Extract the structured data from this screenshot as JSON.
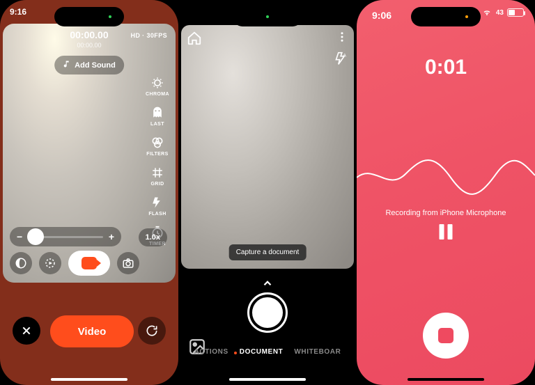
{
  "phone1": {
    "status_time": "9:16",
    "rec_time": "00:00.00",
    "rec_sub": "00:00.00",
    "quality": "HD · 30FPS",
    "add_sound": "Add Sound",
    "tools": {
      "chroma": "CHROMA",
      "last": "LAST",
      "filters": "FILTERS",
      "grid": "GRID",
      "flash": "FLASH",
      "timer": "TIMER"
    },
    "zoom": "1.0x",
    "video_btn": "Video"
  },
  "phone2": {
    "hint": "Capture a document",
    "modes": {
      "actions": "ACTIONS",
      "document": "DOCUMENT",
      "whiteboard": "WHITEBOAR"
    }
  },
  "phone3": {
    "status_time": "9:06",
    "battery_pct": "43",
    "timer": "0:01",
    "message": "Recording from iPhone Microphone"
  }
}
